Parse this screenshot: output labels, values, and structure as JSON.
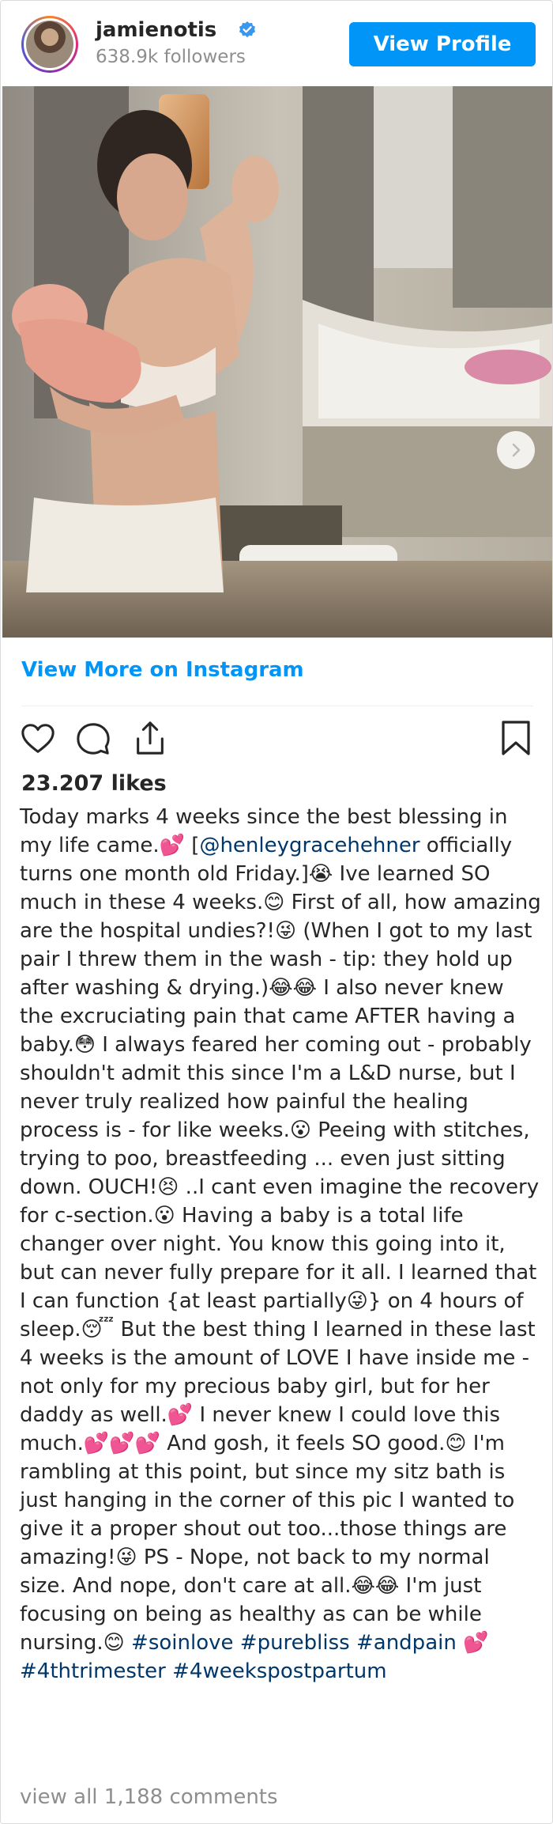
{
  "post": {
    "username": "jamienotis",
    "followers": "638.9k followers",
    "view_profile_label": "View Profile",
    "view_more_label": "View More on Instagram",
    "likes": "23.207 likes",
    "caption": [
      {
        "t": "Today marks 4 weeks since the best blessing in my life came.💕 ["
      },
      {
        "t": "@henleygracehehner",
        "cls": "mention"
      },
      {
        "t": " officially turns one month old Friday.]😭 Ive learned SO much in these 4 weeks.😊 First of all, how amazing are the hospital undies?!😜 (When I got to my last pair I threw them in the wash - tip: they hold up after washing & drying.)😂😂 I also never knew the excruciating pain that came AFTER having a baby.😳 I always feared her coming out - probably shouldn't admit this since I'm a L&D nurse, but I never truly realized how painful the healing process is - for like weeks.😮 Peeing with stitches, trying to poo, breastfeeding ... even just sitting down. OUCH!😣 ..I cant even imagine the recovery for c-section.😮 Having a baby is a total life changer over night. You know this going into it, but can never fully prepare for it all. I learned that I can function {at least partially😜} on 4 hours of sleep.😴 But the best thing I learned in these last 4 weeks is the amount of LOVE I have inside me - not only for my precious baby girl, but for her daddy as well.💕 I never knew I could love this much.💕💕💕 And gosh, it feels SO good.😊 I'm rambling at this point, but since my sitz bath is just hanging in the corner of this pic I wanted to give it a proper shout out too...those things are amazing!😜 PS - Nope, not back to my normal size. And nope, don't care at all.😂😂 I'm just focusing on being as healthy as can be while nursing.😊 "
      },
      {
        "t": "#soinlove",
        "cls": "hashtag"
      },
      {
        "t": " "
      },
      {
        "t": "#purebliss",
        "cls": "hashtag"
      },
      {
        "t": " "
      },
      {
        "t": "#andpain",
        "cls": "hashtag"
      },
      {
        "t": " 💕"
      },
      {
        "t": "#4thtrimester",
        "cls": "hashtag"
      },
      {
        "t": " "
      },
      {
        "t": "#4weekspostpartum",
        "cls": "hashtag"
      }
    ],
    "comments_label": "view all 1,188 comments"
  },
  "colors": {
    "brand_blue": "#0095f6",
    "link_dark": "#00376b",
    "muted_gray": "#8e8e8e",
    "text": "#262626"
  },
  "icons": {
    "verified": "verified-badge-icon",
    "like": "heart-icon",
    "comment": "comment-bubble-icon",
    "share": "share-icon",
    "save": "bookmark-icon",
    "carousel_next": "chevron-right-icon"
  }
}
